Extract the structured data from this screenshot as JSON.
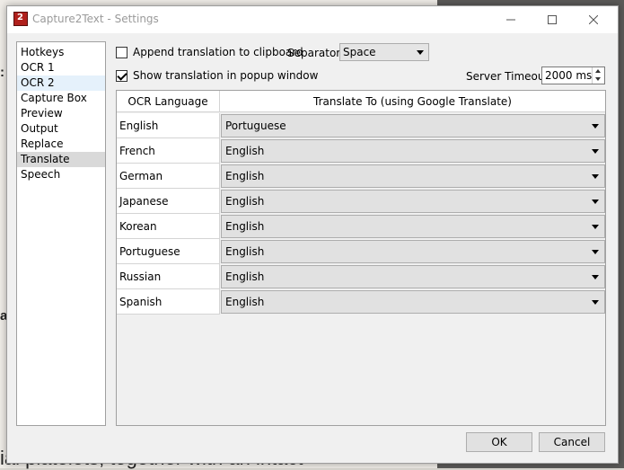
{
  "background": {
    "bottom_text": "ial platelets, together with an intact",
    "letter_a": "a",
    "letter_colon": ":"
  },
  "window": {
    "title": "Capture2Text - Settings",
    "app_icon_text": "2"
  },
  "nav": {
    "items": [
      {
        "label": "Hotkeys"
      },
      {
        "label": "OCR 1"
      },
      {
        "label": "OCR 2"
      },
      {
        "label": "Capture Box"
      },
      {
        "label": "Preview"
      },
      {
        "label": "Output"
      },
      {
        "label": "Replace"
      },
      {
        "label": "Translate"
      },
      {
        "label": "Speech"
      }
    ],
    "selected": "Translate"
  },
  "options": {
    "append_label": "Append translation to clipboard",
    "append_checked": false,
    "show_popup_label": "Show translation in popup window",
    "show_popup_checked": true,
    "separator_label": "Separator:",
    "separator_value": "Space",
    "timeout_label": "Server Timeout:",
    "timeout_value": "2000 ms"
  },
  "table": {
    "headers": [
      "OCR Language",
      "Translate To (using Google Translate)"
    ],
    "rows": [
      {
        "language": "English",
        "target": "Portuguese"
      },
      {
        "language": "French",
        "target": "English"
      },
      {
        "language": "German",
        "target": "English"
      },
      {
        "language": "Japanese",
        "target": "English"
      },
      {
        "language": "Korean",
        "target": "English"
      },
      {
        "language": "Portuguese",
        "target": "English"
      },
      {
        "language": "Russian",
        "target": "English"
      },
      {
        "language": "Spanish",
        "target": "English"
      }
    ]
  },
  "buttons": {
    "ok": "OK",
    "cancel": "Cancel"
  }
}
